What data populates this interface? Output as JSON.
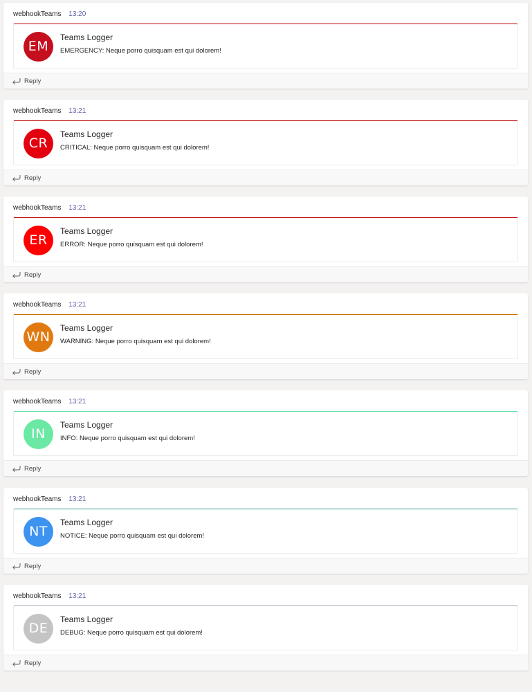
{
  "messages": [
    {
      "sender": "webhookTeams",
      "time": "13:20",
      "card_title": "Teams Logger",
      "initials": "EM",
      "text": "EMERGENCY: Neque porro quisquam est qui dolorem!",
      "color": "#c50f1f",
      "line_color": "#c00000",
      "reply_label": "Reply"
    },
    {
      "sender": "webhookTeams",
      "time": "13:21",
      "card_title": "Teams Logger",
      "initials": "CR",
      "text": "CRITICAL: Neque porro quisquam est qui dolorem!",
      "color": "#e3000f",
      "line_color": "#c00000",
      "reply_label": "Reply"
    },
    {
      "sender": "webhookTeams",
      "time": "13:21",
      "card_title": "Teams Logger",
      "initials": "ER",
      "text": "ERROR: Neque porro quisquam est qui dolorem!",
      "color": "#ff0000",
      "line_color": "#c00000",
      "reply_label": "Reply"
    },
    {
      "sender": "webhookTeams",
      "time": "13:21",
      "card_title": "Teams Logger",
      "initials": "WN",
      "text": "WARNING: Neque porro quisquam est qui dolorem!",
      "color": "#e07a10",
      "line_color": "#d07000",
      "reply_label": "Reply"
    },
    {
      "sender": "webhookTeams",
      "time": "13:21",
      "card_title": "Teams Logger",
      "initials": "IN",
      "text": "INFO: Neque porro quisquam est qui dolorem!",
      "color": "#6be8a4",
      "line_color": "#5fe0a0",
      "reply_label": "Reply"
    },
    {
      "sender": "webhookTeams",
      "time": "13:21",
      "card_title": "Teams Logger",
      "initials": "NT",
      "text": "NOTICE: Neque porro quisquam est qui dolorem!",
      "color": "#3d93f0",
      "line_color": "#2a9d8f",
      "reply_label": "Reply"
    },
    {
      "sender": "webhookTeams",
      "time": "13:21",
      "card_title": "Teams Logger",
      "initials": "DE",
      "text": "DEBUG: Neque porro quisquam est qui dolorem!",
      "color": "#c4c4c4",
      "line_color": "#a0a8b8",
      "reply_label": "Reply"
    }
  ]
}
